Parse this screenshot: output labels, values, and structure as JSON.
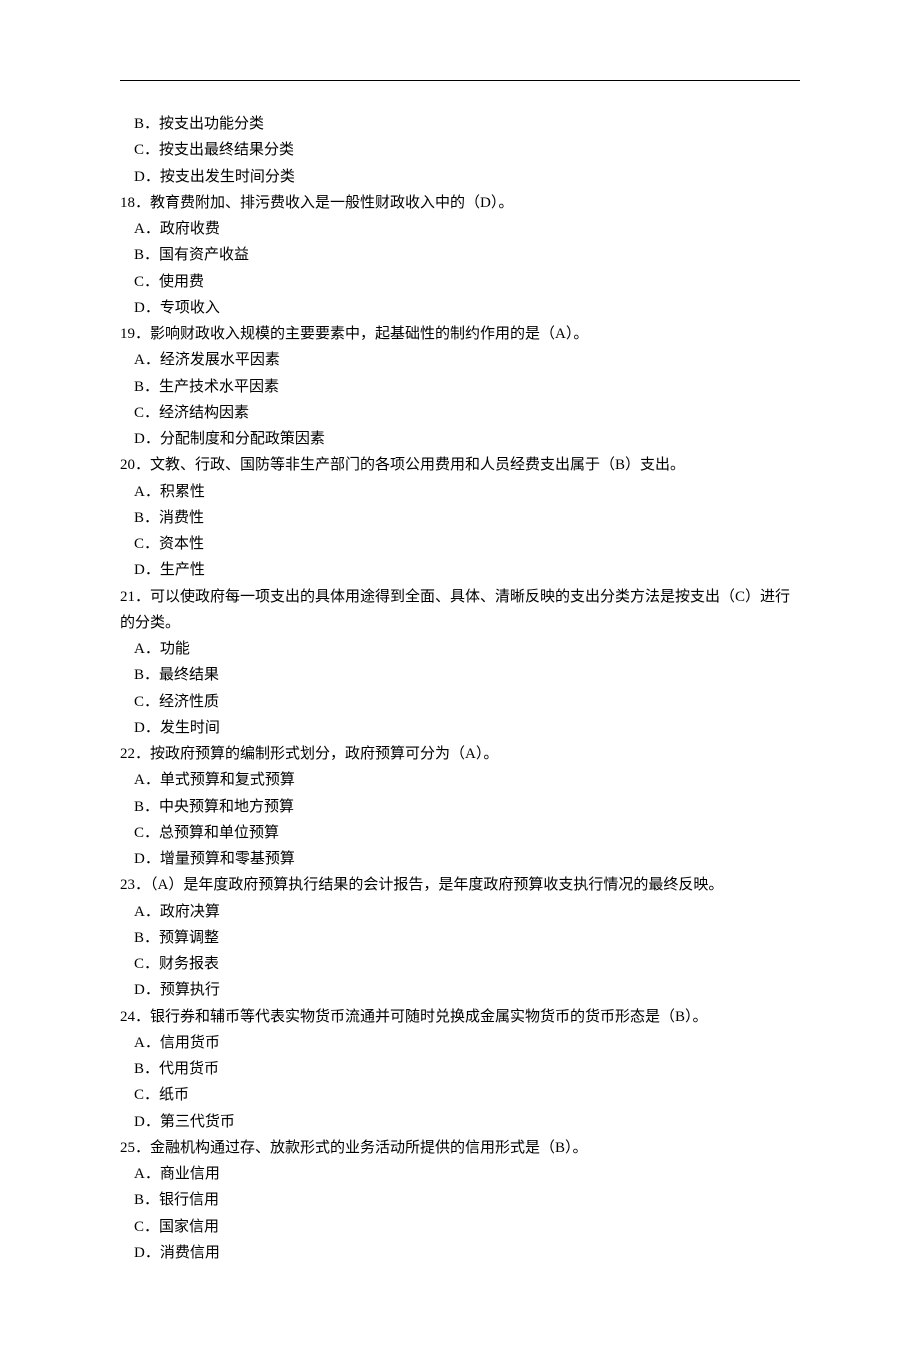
{
  "lines": [
    {
      "cls": "indent-opt",
      "text": "B．按支出功能分类"
    },
    {
      "cls": "indent-opt",
      "text": "C．按支出最终结果分类"
    },
    {
      "cls": "indent-opt",
      "text": "D．按支出发生时间分类"
    },
    {
      "cls": "",
      "text": "18．教育费附加、排污费收入是一般性财政收入中的（D）。"
    },
    {
      "cls": "indent-opt",
      "text": "A．政府收费"
    },
    {
      "cls": "indent-opt",
      "text": "B．国有资产收益"
    },
    {
      "cls": "indent-opt",
      "text": "C．使用费"
    },
    {
      "cls": "indent-opt",
      "text": "D．专项收入"
    },
    {
      "cls": "",
      "text": "19．影响财政收入规模的主要要素中，起基础性的制约作用的是（A）。"
    },
    {
      "cls": "indent-opt",
      "text": "A．经济发展水平因素"
    },
    {
      "cls": "indent-opt",
      "text": "B．生产技术水平因素"
    },
    {
      "cls": "indent-opt",
      "text": "C．经济结构因素"
    },
    {
      "cls": "indent-opt",
      "text": "D．分配制度和分配政策因素"
    },
    {
      "cls": "",
      "text": "20．文教、行政、国防等非生产部门的各项公用费用和人员经费支出属于（B）支出。"
    },
    {
      "cls": "indent-opt",
      "text": "A．积累性"
    },
    {
      "cls": "indent-opt",
      "text": "B．消费性"
    },
    {
      "cls": "indent-opt",
      "text": "C．资本性"
    },
    {
      "cls": "indent-opt",
      "text": "D．生产性"
    },
    {
      "cls": "",
      "text": "21．可以使政府每一项支出的具体用途得到全面、具体、清晰反映的支出分类方法是按支出（C）进行的分类。"
    },
    {
      "cls": "indent-opt",
      "text": "A．功能"
    },
    {
      "cls": "indent-opt",
      "text": "B．最终结果"
    },
    {
      "cls": "indent-opt",
      "text": "C．经济性质"
    },
    {
      "cls": "indent-opt",
      "text": "D．发生时间"
    },
    {
      "cls": "",
      "text": "22．按政府预算的编制形式划分，政府预算可分为（A）。"
    },
    {
      "cls": "indent-opt",
      "text": "A．单式预算和复式预算"
    },
    {
      "cls": "indent-opt",
      "text": "B．中央预算和地方预算"
    },
    {
      "cls": "indent-opt",
      "text": "C．总预算和单位预算"
    },
    {
      "cls": "indent-opt",
      "text": "D．增量预算和零基预算"
    },
    {
      "cls": "",
      "text": "23．（A）是年度政府预算执行结果的会计报告，是年度政府预算收支执行情况的最终反映。"
    },
    {
      "cls": "indent-opt",
      "text": "A．政府决算"
    },
    {
      "cls": "indent-opt",
      "text": "B．预算调整"
    },
    {
      "cls": "indent-opt",
      "text": "C．财务报表"
    },
    {
      "cls": "indent-opt",
      "text": "D．预算执行"
    },
    {
      "cls": "",
      "text": "24．银行券和辅币等代表实物货币流通并可随时兑换成金属实物货币的货币形态是（B）。"
    },
    {
      "cls": "indent-opt",
      "text": "A．信用货币"
    },
    {
      "cls": "indent-opt",
      "text": "B．代用货币"
    },
    {
      "cls": "indent-opt",
      "text": "C．纸币"
    },
    {
      "cls": "indent-opt",
      "text": "D．第三代货币"
    },
    {
      "cls": "",
      "text": "25．金融机构通过存、放款形式的业务活动所提供的信用形式是（B）。"
    },
    {
      "cls": "indent-opt",
      "text": "A．商业信用"
    },
    {
      "cls": "indent-opt",
      "text": "B．银行信用"
    },
    {
      "cls": "indent-opt",
      "text": "C．国家信用"
    },
    {
      "cls": "indent-opt",
      "text": "D．消费信用"
    }
  ]
}
